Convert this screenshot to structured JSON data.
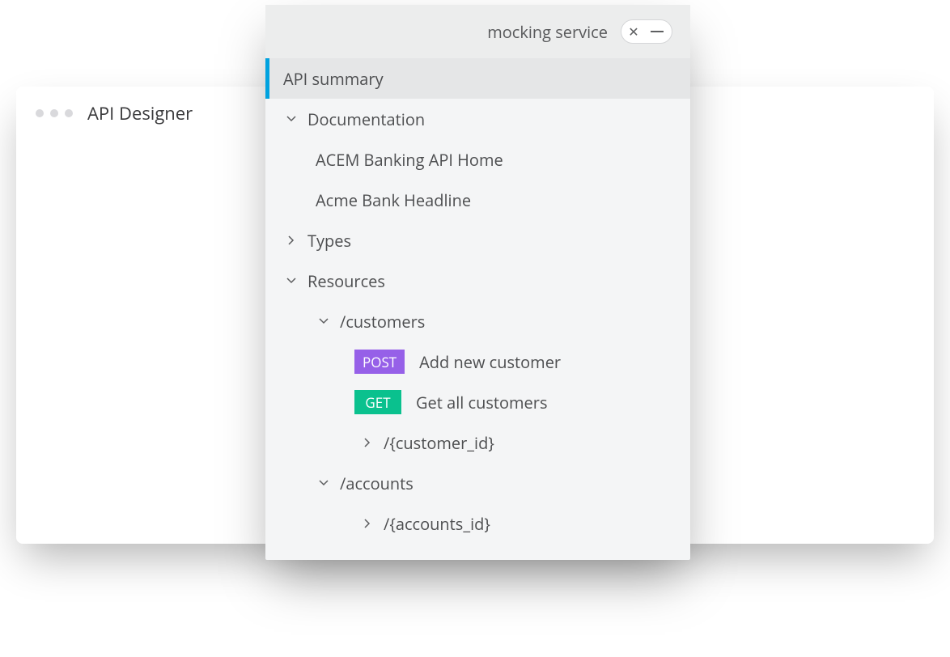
{
  "back_window": {
    "title": "API Designer"
  },
  "panel": {
    "header": {
      "mocking_label": "mocking service",
      "toggle_icon": "✕"
    },
    "nav": {
      "api_summary": "API summary",
      "documentation": {
        "label": "Documentation",
        "items": [
          "ACEM Banking API Home",
          "Acme Bank Headline"
        ]
      },
      "types": {
        "label": "Types"
      },
      "resources": {
        "label": "Resources",
        "customers": {
          "label": "/customers",
          "post": {
            "method": "POST",
            "label": "Add new customer"
          },
          "get": {
            "method": "GET",
            "label": "Get all customers"
          },
          "child": {
            "label": "/{customer_id}"
          }
        },
        "accounts": {
          "label": "/accounts",
          "child": {
            "label": "/{accounts_id}"
          }
        }
      }
    }
  }
}
